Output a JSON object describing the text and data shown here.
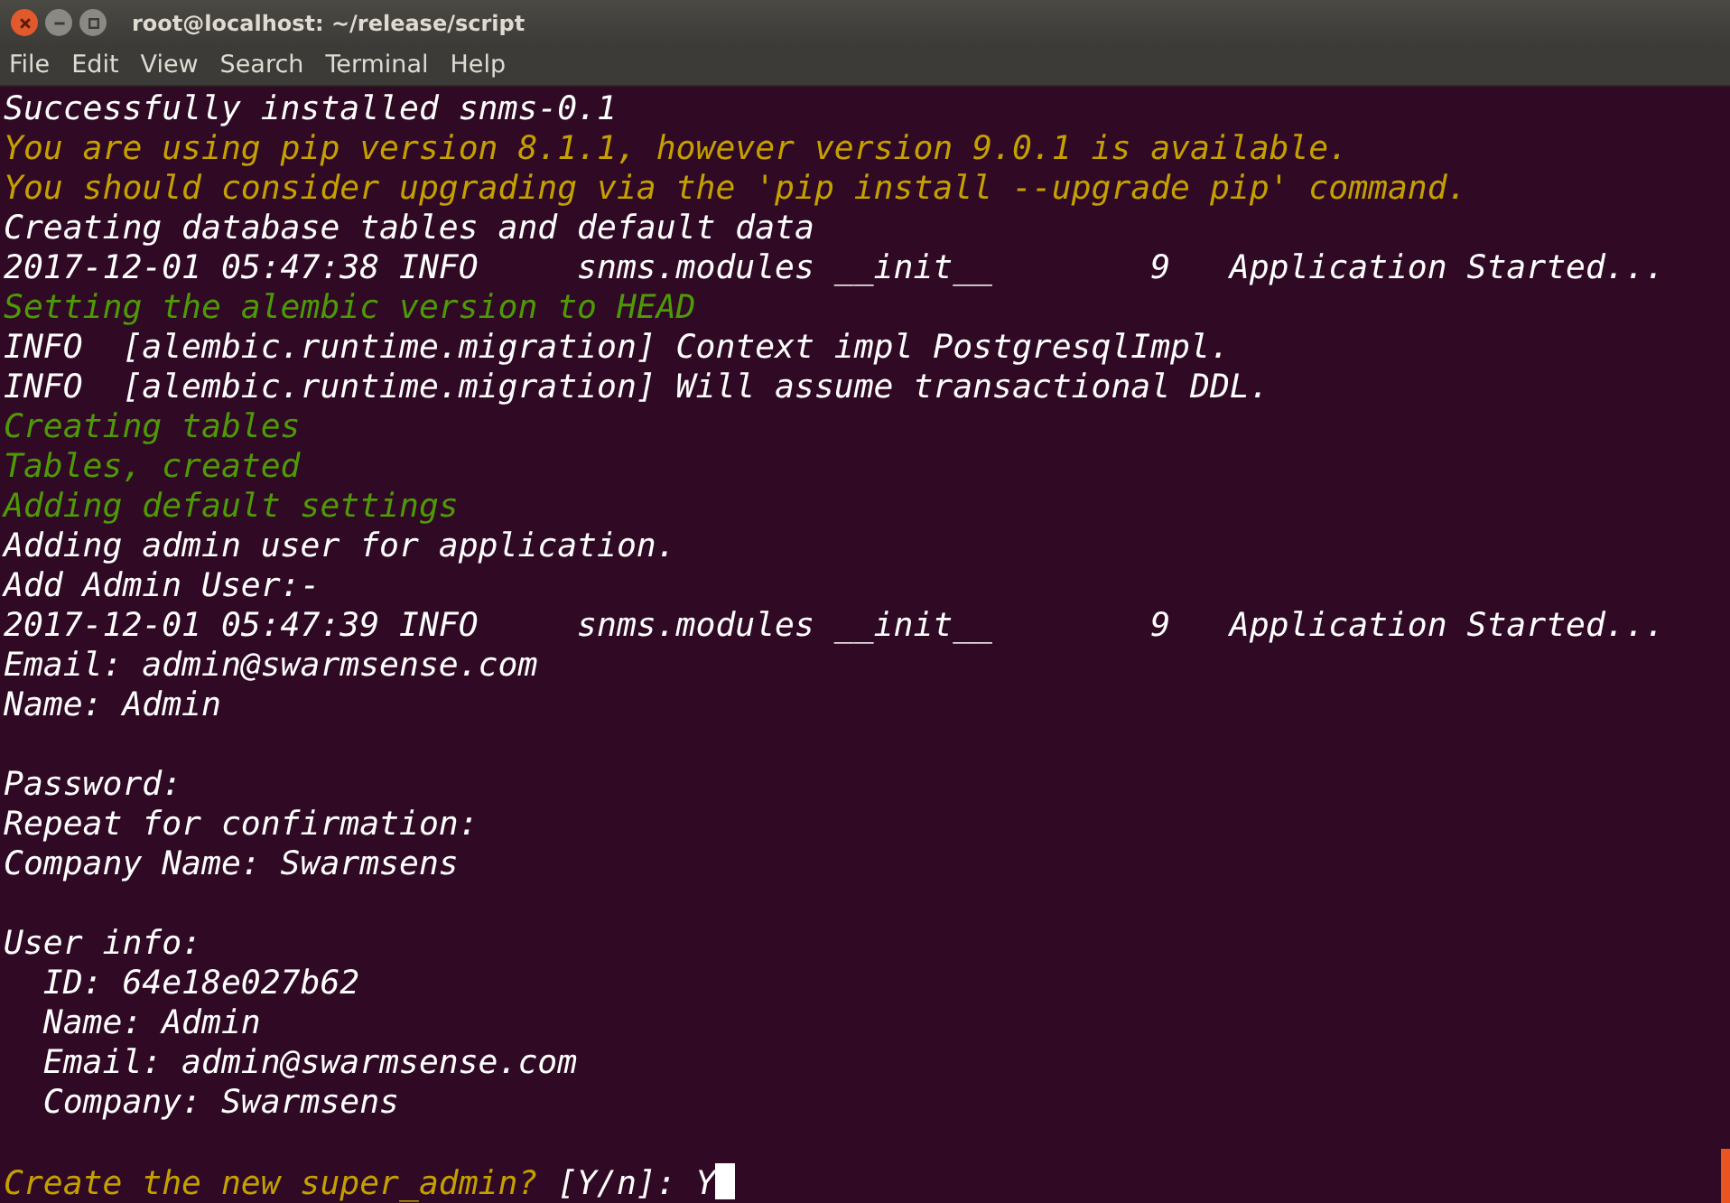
{
  "window": {
    "title": "root@localhost: ~/release/script"
  },
  "menu": [
    "File",
    "Edit",
    "View",
    "Search",
    "Terminal",
    "Help"
  ],
  "lines": [
    {
      "kind": "text",
      "text": "Successfully installed snms-0.1",
      "color": "#ffffff"
    },
    {
      "kind": "text",
      "text": "You are using pip version 8.1.1, however version 9.0.1 is available.",
      "color": "#c4a000"
    },
    {
      "kind": "text",
      "text": "You should consider upgrading via the 'pip install --upgrade pip' command.",
      "color": "#c4a000"
    },
    {
      "kind": "text",
      "text": "Creating database tables and default data",
      "color": "#ffffff"
    },
    {
      "kind": "text",
      "text": "2017-12-01 05:47:38 INFO     snms.modules __init__        9   Application Started...",
      "color": "#ffffff"
    },
    {
      "kind": "text",
      "text": "Setting the alembic version to HEAD",
      "color": "#4e9a06"
    },
    {
      "kind": "text",
      "text": "INFO  [alembic.runtime.migration] Context impl PostgresqlImpl.",
      "color": "#ffffff"
    },
    {
      "kind": "text",
      "text": "INFO  [alembic.runtime.migration] Will assume transactional DDL.",
      "color": "#ffffff"
    },
    {
      "kind": "text",
      "text": "Creating tables",
      "color": "#4e9a06"
    },
    {
      "kind": "text",
      "text": "Tables, created",
      "color": "#4e9a06"
    },
    {
      "kind": "text",
      "text": "Adding default settings",
      "color": "#4e9a06"
    },
    {
      "kind": "text",
      "text": "Adding admin user for application.",
      "color": "#ffffff"
    },
    {
      "kind": "text",
      "text": "Add Admin User:-",
      "color": "#ffffff"
    },
    {
      "kind": "text",
      "text": "2017-12-01 05:47:39 INFO     snms.modules __init__        9   Application Started...",
      "color": "#ffffff"
    },
    {
      "kind": "text",
      "text": "Email: admin@swarmsense.com",
      "color": "#ffffff"
    },
    {
      "kind": "text",
      "text": "Name: Admin",
      "color": "#ffffff"
    },
    {
      "kind": "blank"
    },
    {
      "kind": "text",
      "text": "Password:",
      "color": "#ffffff"
    },
    {
      "kind": "text",
      "text": "Repeat for confirmation:",
      "color": "#ffffff"
    },
    {
      "kind": "text",
      "text": "Company Name: Swarmsens",
      "color": "#ffffff"
    },
    {
      "kind": "blank"
    },
    {
      "kind": "text",
      "text": "User info:",
      "color": "#ffffff"
    },
    {
      "kind": "text",
      "text": "  ID: 64e18e027b62",
      "color": "#ffffff"
    },
    {
      "kind": "text",
      "text": "  Name: Admin",
      "color": "#ffffff"
    },
    {
      "kind": "text",
      "text": "  Email: admin@swarmsense.com",
      "color": "#ffffff"
    },
    {
      "kind": "text",
      "text": "  Company: Swarmsens",
      "color": "#ffffff"
    },
    {
      "kind": "blank"
    },
    {
      "kind": "prompt",
      "segments": [
        {
          "text": "Create the new super_admin?",
          "color": "#c4a000"
        },
        {
          "text": "[Y/n]: Y",
          "color": "#ffffff"
        }
      ],
      "cursor": true
    }
  ]
}
